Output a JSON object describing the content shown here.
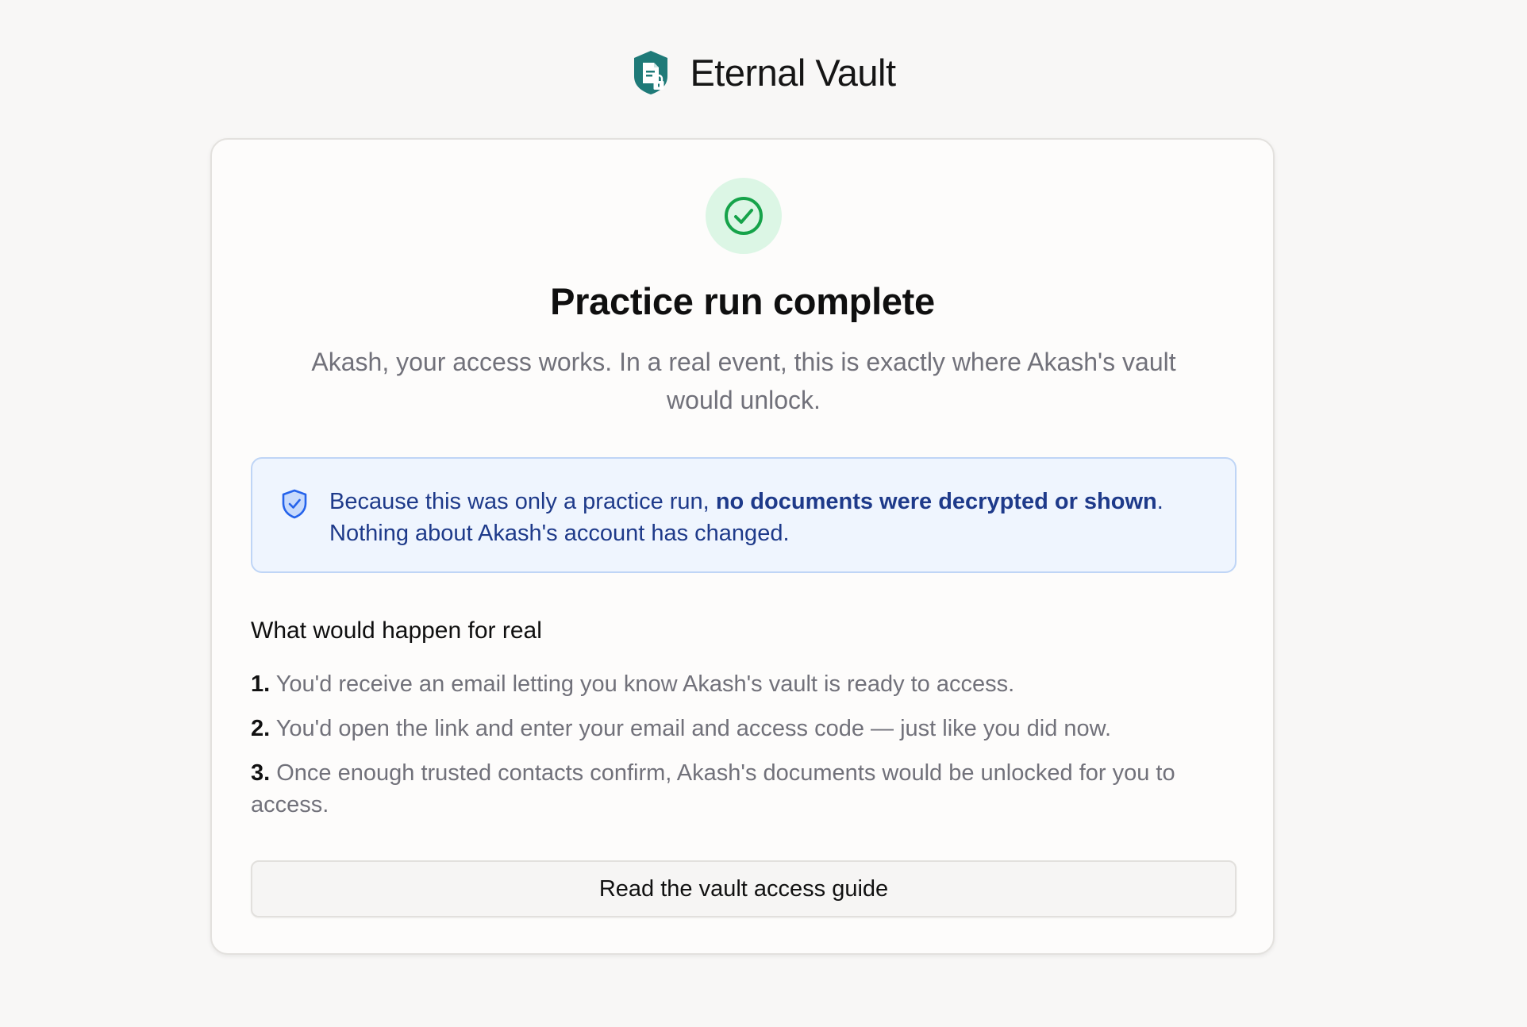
{
  "brand": {
    "name": "Eternal Vault",
    "logo_icon": "vault-shield-document-lock-icon",
    "logo_color": "#1f7a78"
  },
  "card": {
    "status_icon": "check-circle-icon",
    "status_color": "#16a34a",
    "title": "Practice run complete",
    "subtitle": "Akash, your access works. In a real event, this is exactly where Akash's vault would unlock.",
    "notice": {
      "icon": "shield-check-icon",
      "text_before": "Because this was only a practice run, ",
      "text_bold": "no documents were decrypted or shown",
      "text_after": ".",
      "line2": "Nothing about Akash's account has changed.",
      "accent_color": "#1e3a8a",
      "background_color": "#eff5fe"
    },
    "section_title": "What would happen for real",
    "steps": [
      {
        "number": "1.",
        "text": "You'd receive an email letting you know Akash's vault is ready to access."
      },
      {
        "number": "2.",
        "text": "You'd open the link and enter your email and access code — just like you did now."
      },
      {
        "number": "3.",
        "text": "Once enough trusted contacts confirm, Akash's documents would be unlocked for you to access."
      }
    ],
    "button_label": "Read the vault access guide"
  }
}
